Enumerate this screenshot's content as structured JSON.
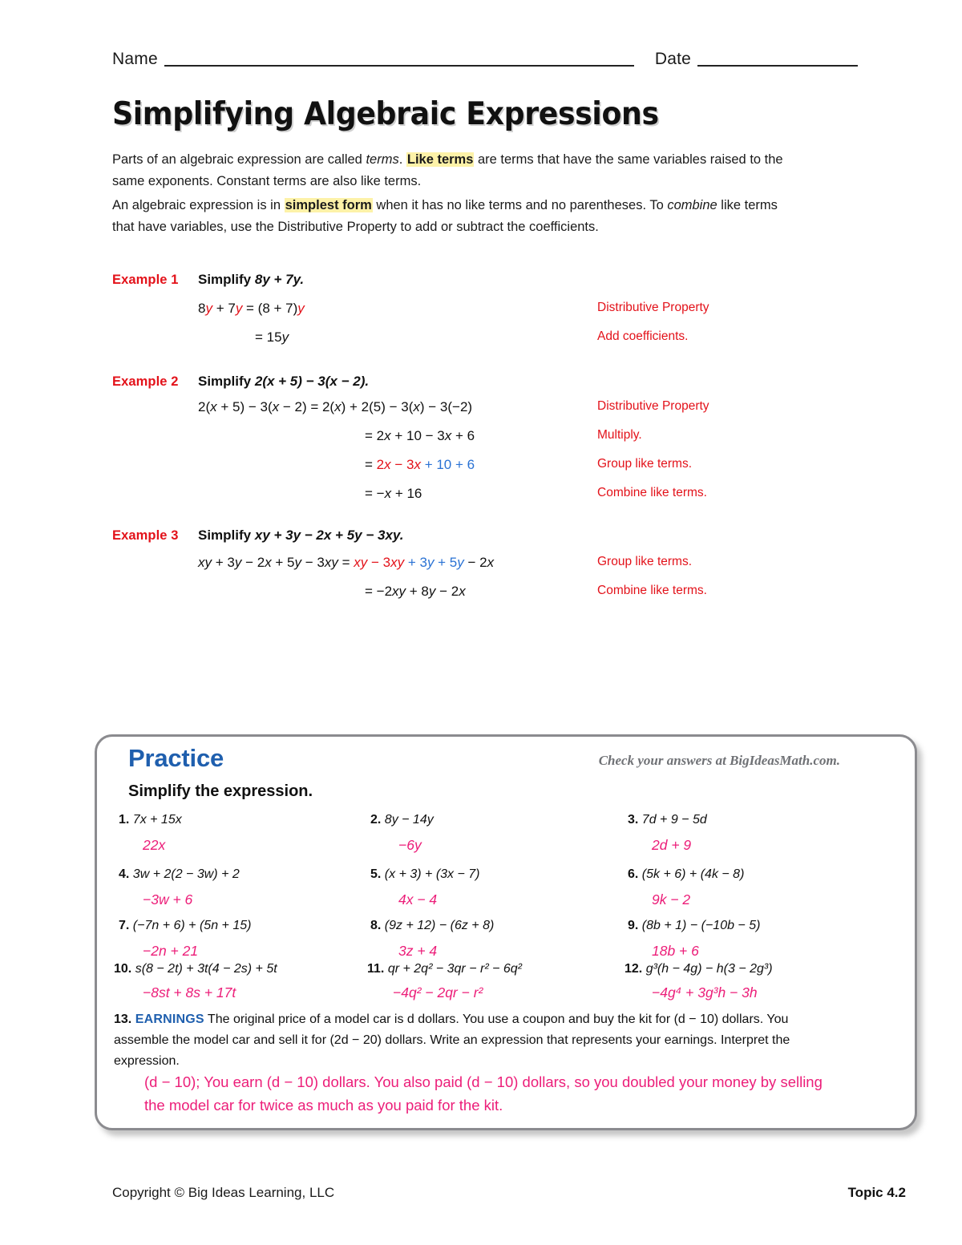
{
  "header": {
    "name_label": "Name",
    "date_label": "Date"
  },
  "title": "Simplifying Algebraic Expressions",
  "intro": {
    "p1_a": "Parts of an algebraic expression are called ",
    "p1_terms": "terms",
    "p1_b": ". ",
    "p1_hl": "Like terms",
    "p1_c": " are terms that have the same variables raised to the same exponents. Constant terms are also like terms.",
    "p2_a": "An algebraic expression is in ",
    "p2_hl": "simplest form",
    "p2_b": " when it has no like terms and no parentheses. To ",
    "p2_combine": "combine",
    "p2_c": " like terms that have variables, use the Distributive Property to add or subtract the coefficients."
  },
  "examples": [
    {
      "label": "Example 1",
      "head_prefix": "Simplify ",
      "head_expr": "8y + 7y.",
      "lines": [
        {
          "note": "Distributive Property"
        },
        {
          "note": "Add coefficients."
        }
      ]
    },
    {
      "label": "Example 2",
      "head_prefix": "Simplify ",
      "head_expr": "2(x + 5) − 3(x − 2).",
      "lines": [
        {
          "note": "Distributive Property"
        },
        {
          "note": "Multiply."
        },
        {
          "note": "Group like terms."
        },
        {
          "note": "Combine like terms."
        }
      ]
    },
    {
      "label": "Example 3",
      "head_prefix": "Simplify ",
      "head_expr": "xy + 3y − 2x + 5y − 3xy.",
      "lines": [
        {
          "note": "Group like terms."
        },
        {
          "note": "Combine like terms."
        }
      ]
    }
  ],
  "example_steps": {
    "e1_l1": "8y + 7y = (8 + 7)y",
    "e1_l2": "= 15y",
    "e2_l1": "2(x + 5) − 3(x − 2) = 2(x) + 2(5) − 3(x) − 3(−2)",
    "e2_l2": "= 2x + 10 − 3x + 6",
    "e2_l3": "= 2x − 3x + 10 + 6",
    "e2_l4": "= −x + 16",
    "e3_l1": "xy + 3y − 2x + 5y − 3xy = xy − 3xy + 3y + 5y − 2x",
    "e3_l2": "= −2xy + 8y − 2x"
  },
  "practice": {
    "title": "Practice",
    "check_answers": "Check your answers at BigIdeasMath.com.",
    "instruction": "Simplify the expression.",
    "problems": [
      {
        "num": "1.",
        "expr": "7x + 15x",
        "answer": "22x"
      },
      {
        "num": "2.",
        "expr": "8y − 14y",
        "answer": "−6y"
      },
      {
        "num": "3.",
        "expr": "7d + 9 − 5d",
        "answer": "2d + 9"
      },
      {
        "num": "4.",
        "expr": "3w + 2(2 − 3w) + 2",
        "answer": "−3w + 6"
      },
      {
        "num": "5.",
        "expr": "(x + 3) + (3x − 7)",
        "answer": "4x − 4"
      },
      {
        "num": "6.",
        "expr": "(5k + 6) + (4k − 8)",
        "answer": "9k − 2"
      },
      {
        "num": "7.",
        "expr": "(−7n + 6) + (5n + 15)",
        "answer": "−2n + 21"
      },
      {
        "num": "8.",
        "expr": "(9z + 12) − (6z + 8)",
        "answer": "3z + 4"
      },
      {
        "num": "9.",
        "expr": "(8b + 1) − (−10b − 5)",
        "answer": "18b + 6"
      },
      {
        "num": "10.",
        "expr": "s(8 − 2t) + 3t(4 − 2s) + 5t",
        "answer": "−8st + 8s + 17t"
      },
      {
        "num": "11.",
        "expr": "qr + 2q² − 3qr − r² − 6q²",
        "answer": "−4q² − 2qr − r²"
      },
      {
        "num": "12.",
        "expr": "g³(h − 4g) − h(3 − 2g³)",
        "answer": "−4g⁴ + 3g³h − 3h"
      }
    ],
    "problem13": {
      "num": "13.",
      "tag": "EARNINGS",
      "body": "The original price of a model car is d dollars. You use a coupon and buy the kit for (d − 10) dollars. You assemble the model car and sell it for (2d − 20) dollars. Write an expression that represents your earnings. Interpret the expression.",
      "answer": "(d − 10); You earn (d − 10) dollars. You also paid (d − 10) dollars, so you doubled your money by selling the model car for twice as much as you paid for the kit."
    }
  },
  "footer": {
    "copyright": "Copyright © Big Ideas Learning, LLC",
    "topic": "Topic 4.2"
  },
  "colors": {
    "accent_red": "#e3121a",
    "accent_blue": "#1f5fae",
    "answer_magenta": "#ec1e79",
    "highlight_yellow": "#fdf2a8"
  }
}
